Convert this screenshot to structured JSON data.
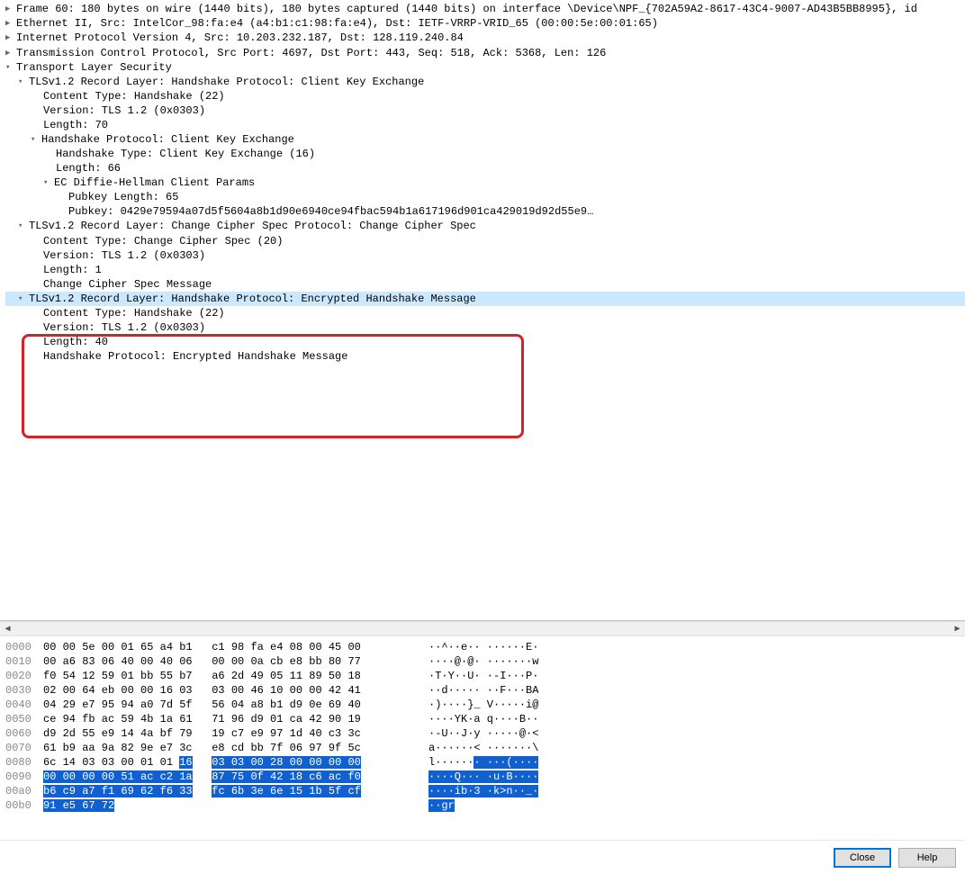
{
  "details": {
    "frame": "Frame 60: 180 bytes on wire (1440 bits), 180 bytes captured (1440 bits) on interface \\Device\\NPF_{702A59A2-8617-43C4-9007-AD43B5BB8995}, id",
    "eth": "Ethernet II, Src: IntelCor_98:fa:e4 (a4:b1:c1:98:fa:e4), Dst: IETF-VRRP-VRID_65 (00:00:5e:00:01:65)",
    "ip": "Internet Protocol Version 4, Src: 10.203.232.187, Dst: 128.119.240.84",
    "tcp": "Transmission Control Protocol, Src Port: 4697, Dst Port: 443, Seq: 518, Ack: 5368, Len: 126",
    "tls": "Transport Layer Security",
    "rec1": "TLSv1.2 Record Layer: Handshake Protocol: Client Key Exchange",
    "rec1_ct": "Content Type: Handshake (22)",
    "rec1_ver": "Version: TLS 1.2 (0x0303)",
    "rec1_len": "Length: 70",
    "hs1": "Handshake Protocol: Client Key Exchange",
    "hs1_type": "Handshake Type: Client Key Exchange (16)",
    "hs1_len": "Length: 66",
    "ecdh": "EC Diffie-Hellman Client Params",
    "ecdh_pklen": "Pubkey Length: 65",
    "ecdh_pk": "Pubkey: 0429e79594a07d5f5604a8b1d90e6940ce94fbac594b1a617196d901ca429019d92d55e9…",
    "rec2": "TLSv1.2 Record Layer: Change Cipher Spec Protocol: Change Cipher Spec",
    "rec2_ct": "Content Type: Change Cipher Spec (20)",
    "rec2_ver": "Version: TLS 1.2 (0x0303)",
    "rec2_len": "Length: 1",
    "rec2_msg": "Change Cipher Spec Message",
    "rec3": "TLSv1.2 Record Layer: Handshake Protocol: Encrypted Handshake Message",
    "rec3_ct": "Content Type: Handshake (22)",
    "rec3_ver": "Version: TLS 1.2 (0x0303)",
    "rec3_len": "Length: 40",
    "rec3_hs": "Handshake Protocol: Encrypted Handshake Message"
  },
  "hex": [
    {
      "off": "0000",
      "b1": "00 00 5e 00 01 65 a4 b1",
      "b2": "c1 98 fa e4 08 00 45 00",
      "a": "··^··e·· ······E·"
    },
    {
      "off": "0010",
      "b1": "00 a6 83 06 40 00 40 06",
      "b2": "00 00 0a cb e8 bb 80 77",
      "a": "····@·@· ·······w"
    },
    {
      "off": "0020",
      "b1": "f0 54 12 59 01 bb 55 b7",
      "b2": "a6 2d 49 05 11 89 50 18",
      "a": "·T·Y··U· ·-I···P·"
    },
    {
      "off": "0030",
      "b1": "02 00 64 eb 00 00 16 03",
      "b2": "03 00 46 10 00 00 42 41",
      "a": "··d····· ··F···BA"
    },
    {
      "off": "0040",
      "b1": "04 29 e7 95 94 a0 7d 5f",
      "b2": "56 04 a8 b1 d9 0e 69 40",
      "a": "·)····}_ V·····i@"
    },
    {
      "off": "0050",
      "b1": "ce 94 fb ac 59 4b 1a 61",
      "b2": "71 96 d9 01 ca 42 90 19",
      "a": "····YK·a q····B··"
    },
    {
      "off": "0060",
      "b1": "d9 2d 55 e9 14 4a bf 79",
      "b2": "19 c7 e9 97 1d 40 c3 3c",
      "a": "·-U··J·y ·····@·<"
    },
    {
      "off": "0070",
      "b1": "61 b9 aa 9a 82 9e e7 3c",
      "b2": "e8 cd bb 7f 06 97 9f 5c",
      "a": "a······< ·······\\"
    }
  ],
  "hex_hl": [
    {
      "off": "0080",
      "b1_plain": "6c 14 03 03 00 01 01 ",
      "b1_hl": "16",
      "b2_hl": "03 03 00 28 00 00 00 00",
      "a_plain": "l······",
      "a_hl": "· ···(····"
    },
    {
      "off": "0090",
      "b1_hl": "00 00 00 00 51 ac c2 1a",
      "b2_hl": "87 75 0f 42 18 c6 ac f0",
      "a_hl": "····Q··· ·u·B····"
    },
    {
      "off": "00a0",
      "b1_hl": "b6 c9 a7 f1 69 62 f6 33",
      "b2_hl": "fc 6b 3e 6e 15 1b 5f cf",
      "a_hl": "····ib·3 ·k>n··_·"
    },
    {
      "off": "00b0",
      "b1_hl": "91 e5 67 72",
      "b2_hl": "",
      "a_hl": "··gr"
    }
  ],
  "buttons": {
    "close": "Close",
    "help": "Help"
  }
}
